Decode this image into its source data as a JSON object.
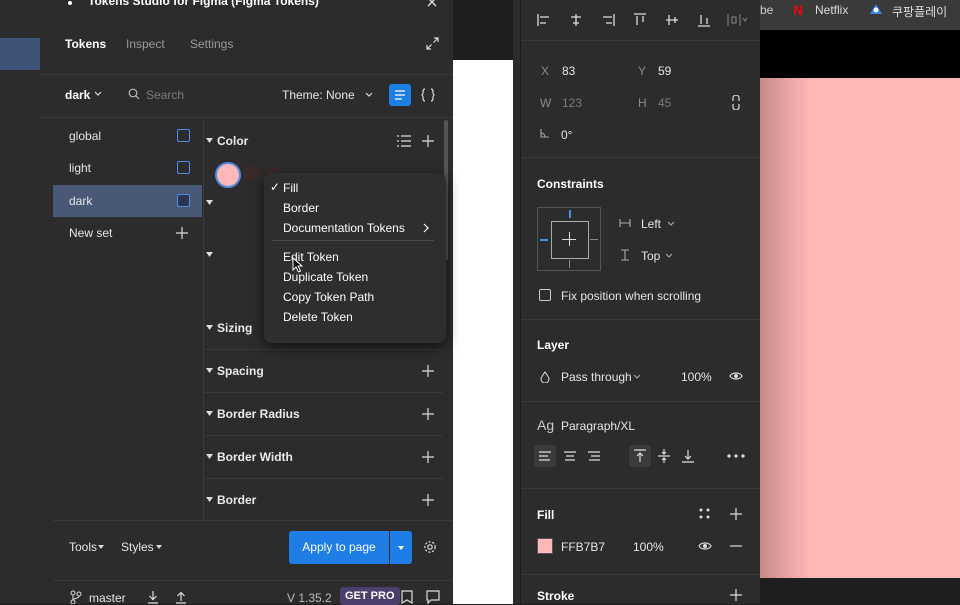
{
  "plugin": {
    "title": "Tokens Studio for Figma (Figma Tokens)",
    "tabs": [
      {
        "label": "Tokens"
      },
      {
        "label": "Inspect"
      },
      {
        "label": "Settings"
      }
    ],
    "toolbar": {
      "theme_set": "dark",
      "search_placeholder": "Search",
      "theme_label": "Theme: None"
    },
    "sets": [
      {
        "label": "global"
      },
      {
        "label": "light"
      },
      {
        "label": "dark"
      },
      {
        "label": "New set"
      }
    ],
    "groups": [
      {
        "label": "Color"
      },
      {
        "label": "Sizing"
      },
      {
        "label": "Spacing"
      },
      {
        "label": "Border Radius"
      },
      {
        "label": "Border Width"
      },
      {
        "label": "Border"
      }
    ],
    "footer": {
      "tools_label": "Tools",
      "styles_label": "Styles",
      "apply_label": "Apply to page",
      "branch": "master",
      "version": "V 1.35.2",
      "getpro_label": "GET PRO"
    }
  },
  "context_menu": {
    "items": [
      {
        "label": "Fill"
      },
      {
        "label": "Border"
      },
      {
        "label": "Documentation Tokens"
      },
      {
        "label": "Edit Token"
      },
      {
        "label": "Duplicate Token"
      },
      {
        "label": "Copy Token Path"
      },
      {
        "label": "Delete Token"
      }
    ]
  },
  "props": {
    "x_label": "X",
    "x_value": "83",
    "y_label": "Y",
    "y_value": "59",
    "w_label": "W",
    "w_value": "123",
    "h_label": "H",
    "h_value": "45",
    "rotation": "0°",
    "constraints_title": "Constraints",
    "constraint_h": "Left",
    "constraint_v": "Top",
    "fix_position_label": "Fix position when scrolling",
    "layer_title": "Layer",
    "blend_mode": "Pass through",
    "layer_opacity": "100%",
    "text_style_icon": "Ag",
    "text_style": "Paragraph/XL",
    "fill_title": "Fill",
    "fill_hex": "FFB7B7",
    "fill_opacity": "100%",
    "fill_color": "#ffb7b7",
    "stroke_title": "Stroke"
  },
  "browser": {
    "tab_partial": "be",
    "tab_netflix": "Netflix",
    "tab_coupang": "쿠팡플레이"
  },
  "colors": {
    "accent": "#1e7ee6",
    "selected_set": "#4a5878",
    "canvas_pink": "#ffb7b7"
  }
}
